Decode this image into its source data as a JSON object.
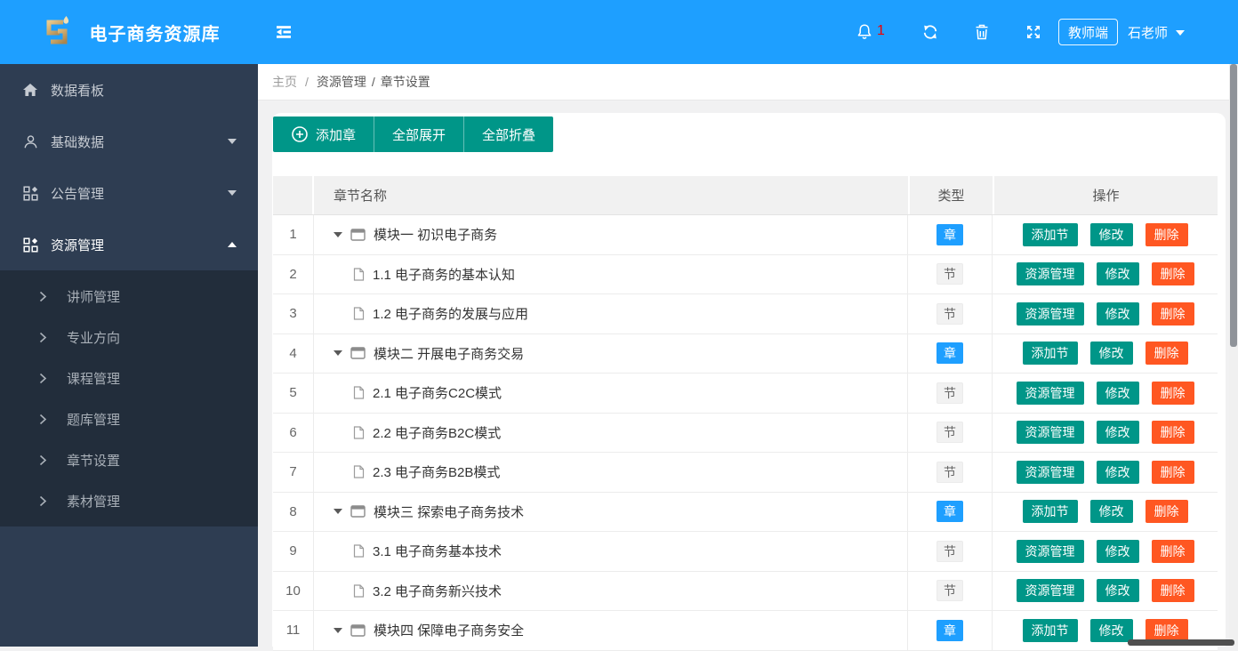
{
  "app": {
    "title": "电子商务资源库"
  },
  "header": {
    "notification_count": "1",
    "role_badge": "教师端",
    "username": "石老师"
  },
  "sidebar": {
    "items": [
      {
        "label": "数据看板",
        "icon": "home-icon",
        "arrow": "none",
        "active": false
      },
      {
        "label": "基础数据",
        "icon": "user-icon",
        "arrow": "down",
        "active": false
      },
      {
        "label": "公告管理",
        "icon": "apps-icon",
        "arrow": "down",
        "active": false
      },
      {
        "label": "资源管理",
        "icon": "apps-icon",
        "arrow": "up",
        "active": true
      }
    ],
    "submenu_items": [
      "讲师管理",
      "专业方向",
      "课程管理",
      "题库管理",
      "章节设置",
      "素材管理"
    ]
  },
  "breadcrumb": {
    "items": [
      "主页",
      "资源管理",
      "章节设置"
    ],
    "separator": "/"
  },
  "toolbar": {
    "add_chapter": "添加章",
    "expand_all": "全部展开",
    "collapse_all": "全部折叠"
  },
  "table": {
    "columns": {
      "index": "",
      "name": "章节名称",
      "type": "类型",
      "actions": "操作"
    },
    "rows": [
      {
        "index": "1",
        "name": "模块一 初识电子商务",
        "kind": "chapter",
        "type": "章",
        "actions": [
          {
            "label": "添加节",
            "style": "teal",
            "name": "add-section-button"
          },
          {
            "label": "修改",
            "style": "teal",
            "name": "edit-button"
          },
          {
            "label": "删除",
            "style": "orange",
            "name": "delete-button"
          }
        ]
      },
      {
        "index": "2",
        "name": "1.1 电子商务的基本认知",
        "kind": "section",
        "type": "节",
        "actions": [
          {
            "label": "资源管理",
            "style": "teal",
            "name": "resource-manage-button"
          },
          {
            "label": "修改",
            "style": "teal",
            "name": "edit-button"
          },
          {
            "label": "删除",
            "style": "orange",
            "name": "delete-button"
          }
        ]
      },
      {
        "index": "3",
        "name": "1.2 电子商务的发展与应用",
        "kind": "section",
        "type": "节",
        "actions": [
          {
            "label": "资源管理",
            "style": "teal",
            "name": "resource-manage-button"
          },
          {
            "label": "修改",
            "style": "teal",
            "name": "edit-button"
          },
          {
            "label": "删除",
            "style": "orange",
            "name": "delete-button"
          }
        ]
      },
      {
        "index": "4",
        "name": "模块二 开展电子商务交易",
        "kind": "chapter",
        "type": "章",
        "actions": [
          {
            "label": "添加节",
            "style": "teal",
            "name": "add-section-button"
          },
          {
            "label": "修改",
            "style": "teal",
            "name": "edit-button"
          },
          {
            "label": "删除",
            "style": "orange",
            "name": "delete-button"
          }
        ]
      },
      {
        "index": "5",
        "name": "2.1 电子商务C2C模式",
        "kind": "section",
        "type": "节",
        "actions": [
          {
            "label": "资源管理",
            "style": "teal",
            "name": "resource-manage-button"
          },
          {
            "label": "修改",
            "style": "teal",
            "name": "edit-button"
          },
          {
            "label": "删除",
            "style": "orange",
            "name": "delete-button"
          }
        ]
      },
      {
        "index": "6",
        "name": "2.2 电子商务B2C模式",
        "kind": "section",
        "type": "节",
        "actions": [
          {
            "label": "资源管理",
            "style": "teal",
            "name": "resource-manage-button"
          },
          {
            "label": "修改",
            "style": "teal",
            "name": "edit-button"
          },
          {
            "label": "删除",
            "style": "orange",
            "name": "delete-button"
          }
        ]
      },
      {
        "index": "7",
        "name": "2.3 电子商务B2B模式",
        "kind": "section",
        "type": "节",
        "actions": [
          {
            "label": "资源管理",
            "style": "teal",
            "name": "resource-manage-button"
          },
          {
            "label": "修改",
            "style": "teal",
            "name": "edit-button"
          },
          {
            "label": "删除",
            "style": "orange",
            "name": "delete-button"
          }
        ]
      },
      {
        "index": "8",
        "name": "模块三 探索电子商务技术",
        "kind": "chapter",
        "type": "章",
        "actions": [
          {
            "label": "添加节",
            "style": "teal",
            "name": "add-section-button"
          },
          {
            "label": "修改",
            "style": "teal",
            "name": "edit-button"
          },
          {
            "label": "删除",
            "style": "orange",
            "name": "delete-button"
          }
        ]
      },
      {
        "index": "9",
        "name": "3.1 电子商务基本技术",
        "kind": "section",
        "type": "节",
        "actions": [
          {
            "label": "资源管理",
            "style": "teal",
            "name": "resource-manage-button"
          },
          {
            "label": "修改",
            "style": "teal",
            "name": "edit-button"
          },
          {
            "label": "删除",
            "style": "orange",
            "name": "delete-button"
          }
        ]
      },
      {
        "index": "10",
        "name": "3.2 电子商务新兴技术",
        "kind": "section",
        "type": "节",
        "actions": [
          {
            "label": "资源管理",
            "style": "teal",
            "name": "resource-manage-button"
          },
          {
            "label": "修改",
            "style": "teal",
            "name": "edit-button"
          },
          {
            "label": "删除",
            "style": "orange",
            "name": "delete-button"
          }
        ]
      },
      {
        "index": "11",
        "name": "模块四 保障电子商务安全",
        "kind": "chapter",
        "type": "章",
        "actions": [
          {
            "label": "添加节",
            "style": "teal",
            "name": "add-section-button"
          },
          {
            "label": "修改",
            "style": "teal",
            "name": "edit-button"
          },
          {
            "label": "删除",
            "style": "orange",
            "name": "delete-button"
          }
        ]
      }
    ]
  },
  "icons": {
    "header": [
      "logo-icon",
      "collapse-menu-icon",
      "bell-icon",
      "refresh-icon",
      "trash-icon",
      "fullscreen-icon",
      "caret-down-icon"
    ],
    "sidebar": [
      "home-icon",
      "user-icon",
      "apps-icon",
      "chevron-right-icon"
    ],
    "toolbar": [
      "plus-circle-icon"
    ],
    "rows": [
      "caret-down-icon",
      "chapter-window-icon",
      "section-file-icon"
    ]
  },
  "colors": {
    "primary_blue": "#1E9FFF",
    "action_teal": "#009688",
    "danger_orange": "#FF5722",
    "sidebar_bg": "#2E3D52",
    "submenu_bg": "#222D3B",
    "chapter_badge": "#1E9FFF",
    "notification_red": "#F20000",
    "logo_gold": "#C9A35F",
    "table_header_bg": "#F1F1F1"
  }
}
